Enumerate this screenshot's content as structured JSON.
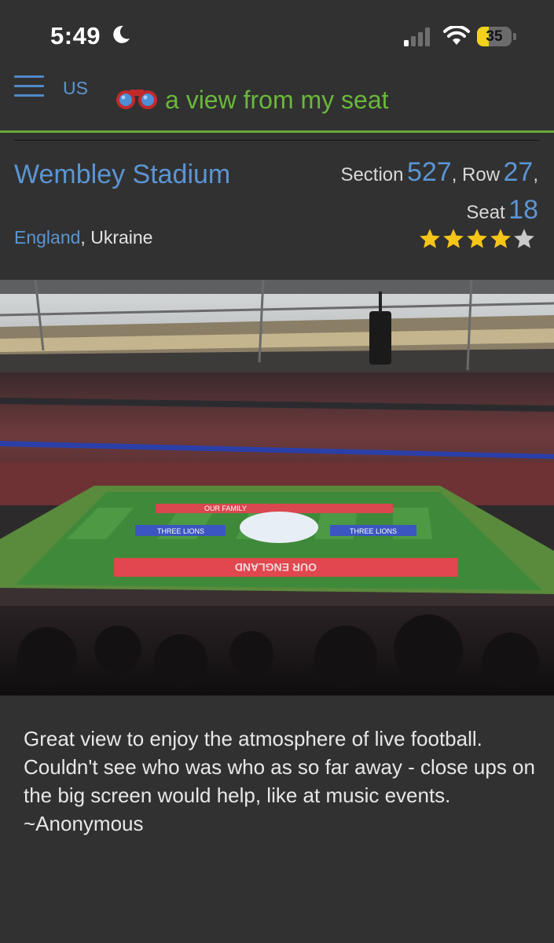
{
  "status_bar": {
    "time": "5:49",
    "battery": "35",
    "battery_color": "#f2d21b",
    "battery_level": 0.35
  },
  "header": {
    "country": "US",
    "title": "a view from my seat"
  },
  "venue": {
    "name": "Wembley Stadium",
    "teams": {
      "home": "England",
      "away": "Ukraine",
      "separator": ", "
    }
  },
  "seat": {
    "section_label": "Section",
    "section": "527",
    "row_label": "Row",
    "row": "27",
    "seat_label": "Seat",
    "seat": "18",
    "rating": 4,
    "rating_max": 5
  },
  "photo": {
    "banners": [
      "OUR FAMILY",
      "OUR ENGLAND",
      "THREE LIONS",
      "THREE LIONS"
    ]
  },
  "review": {
    "text": "Great view to enjoy the atmosphere of live football. Couldn't see who was who as so far away - close ups on the big screen would help, like at music events.",
    "author": "~Anonymous"
  },
  "colors": {
    "link": "#5b95d3",
    "brand_green": "#69b83a",
    "background": "#313131",
    "star_gold": "#f5c518",
    "star_empty": "#c9c9c9"
  }
}
